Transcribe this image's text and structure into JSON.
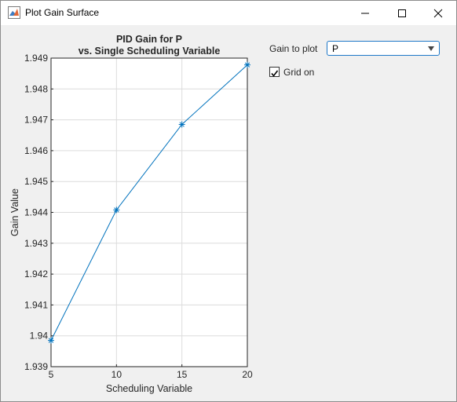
{
  "window": {
    "title": "Plot Gain Surface",
    "buttons": {
      "minimize": "—",
      "maximize": "☐",
      "close": "✕"
    }
  },
  "controls": {
    "gain_label": "Gain to plot",
    "gain_selected": "P",
    "grid_label": "Grid on",
    "grid_checked": true
  },
  "chart_data": {
    "type": "line",
    "title_line1": "PID Gain for P",
    "title_line2": "vs. Single Scheduling Variable",
    "xlabel": "Scheduling Variable",
    "ylabel": "Gain Value",
    "xlim": [
      5,
      20
    ],
    "ylim": [
      1.939,
      1.949
    ],
    "xticks": [
      5,
      10,
      15,
      20
    ],
    "yticks": [
      1.939,
      1.94,
      1.941,
      1.942,
      1.943,
      1.944,
      1.945,
      1.946,
      1.947,
      1.948,
      1.949
    ],
    "grid": true,
    "series": [
      {
        "x": [
          5,
          10,
          15,
          20
        ],
        "y": [
          1.93985,
          1.94408,
          1.94685,
          1.94878
        ],
        "color": "#0072bd",
        "marker": "*"
      }
    ]
  }
}
